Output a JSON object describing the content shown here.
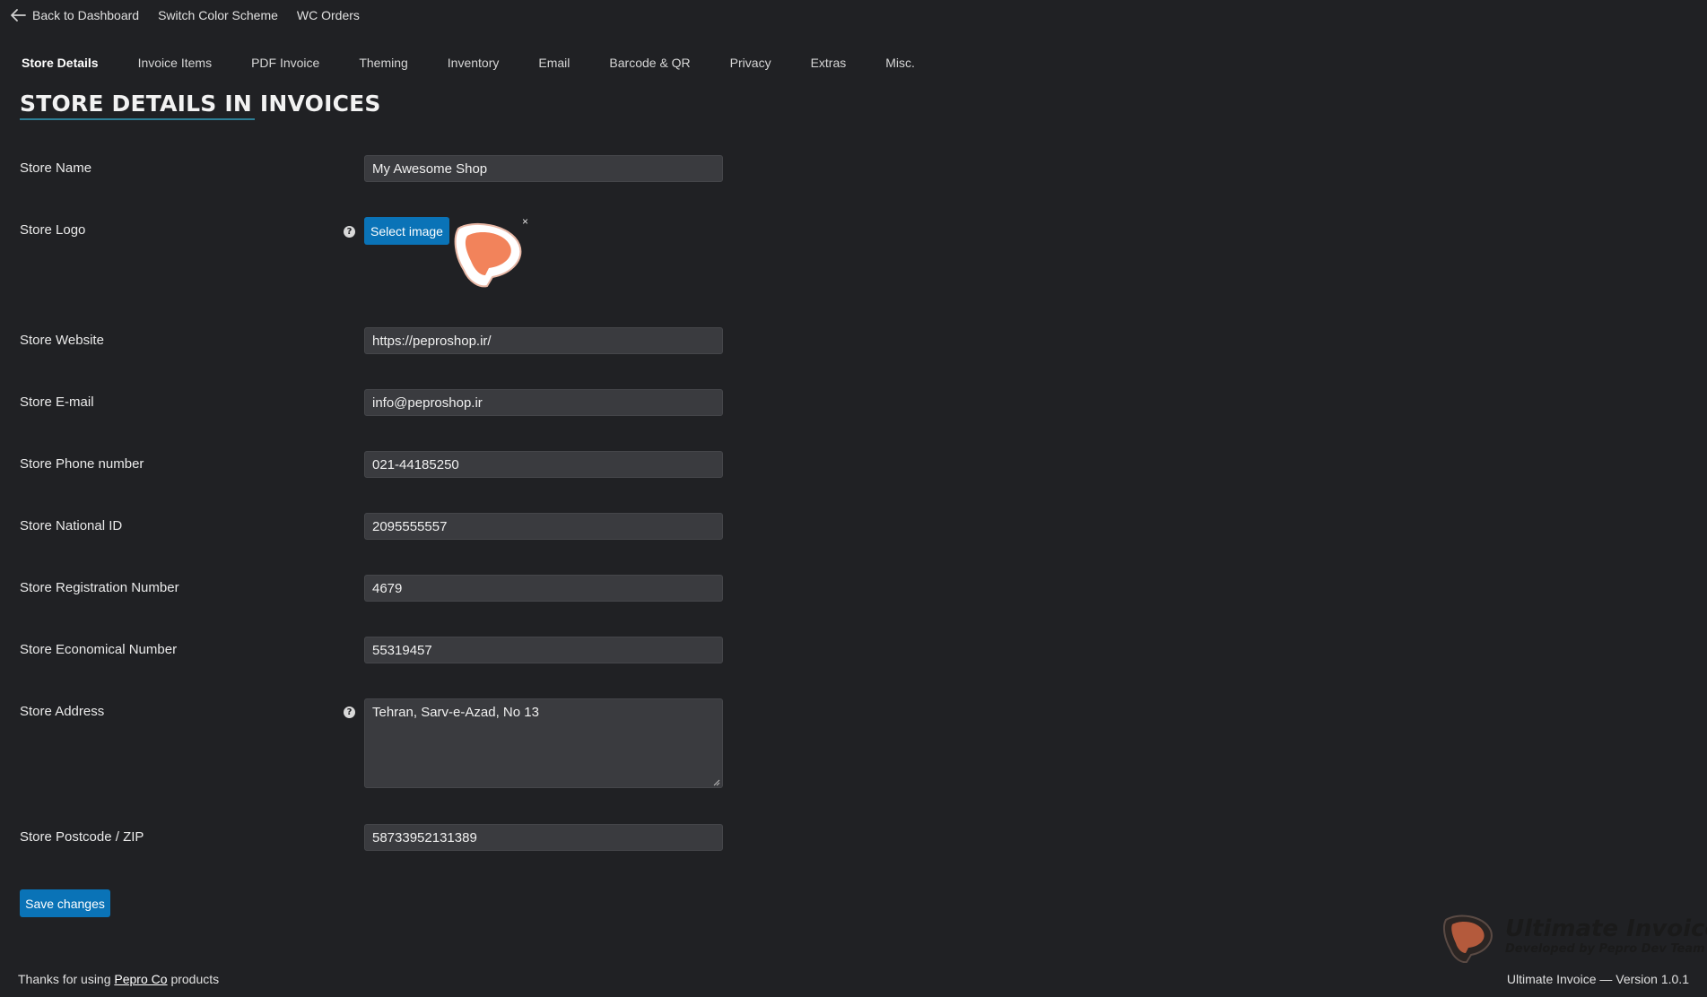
{
  "topbar": {
    "back_label": "Back to Dashboard",
    "color_scheme_label": "Switch Color Scheme",
    "orders_label": "WC Orders"
  },
  "tabs": [
    {
      "label": "Store Details",
      "active": true
    },
    {
      "label": "Invoice Items",
      "active": false
    },
    {
      "label": "PDF Invoice",
      "active": false
    },
    {
      "label": "Theming",
      "active": false
    },
    {
      "label": "Inventory",
      "active": false
    },
    {
      "label": "Email",
      "active": false
    },
    {
      "label": "Barcode & QR",
      "active": false
    },
    {
      "label": "Privacy",
      "active": false
    },
    {
      "label": "Extras",
      "active": false
    },
    {
      "label": "Misc.",
      "active": false
    }
  ],
  "page_title": "STORE DETAILS IN INVOICES",
  "form": {
    "store_name": {
      "label": "Store Name",
      "value": "My Awesome Shop"
    },
    "store_logo": {
      "label": "Store Logo",
      "button": "Select image",
      "remove": "×",
      "help": "?"
    },
    "store_website": {
      "label": "Store Website",
      "value": "https://peproshop.ir/"
    },
    "store_email": {
      "label": "Store E-mail",
      "value": "info@peproshop.ir"
    },
    "store_phone": {
      "label": "Store Phone number",
      "value": "021-44185250"
    },
    "store_national_id": {
      "label": "Store National ID",
      "value": "2095555557"
    },
    "store_registration": {
      "label": "Store Registration Number",
      "value": "4679"
    },
    "store_economical": {
      "label": "Store Economical Number",
      "value": "55319457"
    },
    "store_address": {
      "label": "Store Address",
      "value": "Tehran, Sarv-e-Azad, No 13",
      "help": "?"
    },
    "store_postcode": {
      "label": "Store Postcode / ZIP",
      "value": "58733952131389"
    }
  },
  "save_label": "Save changes",
  "footer": {
    "thanks_prefix": "Thanks for using",
    "company_link": "Pepro Co",
    "thanks_suffix": "products",
    "version": "Ultimate Invoice — Version 1.0.1"
  },
  "brand": {
    "title": "Ultimate Invoice",
    "subtitle": "Developed by Pepro Dev Team"
  },
  "colors": {
    "background": "#202124",
    "field": "#3a3b3f",
    "accent": "#0a73b7",
    "logo_orange": "#f2835b"
  },
  "icons": [
    "arrow-left-icon",
    "help-icon",
    "close-icon",
    "pepro-logo-icon"
  ]
}
